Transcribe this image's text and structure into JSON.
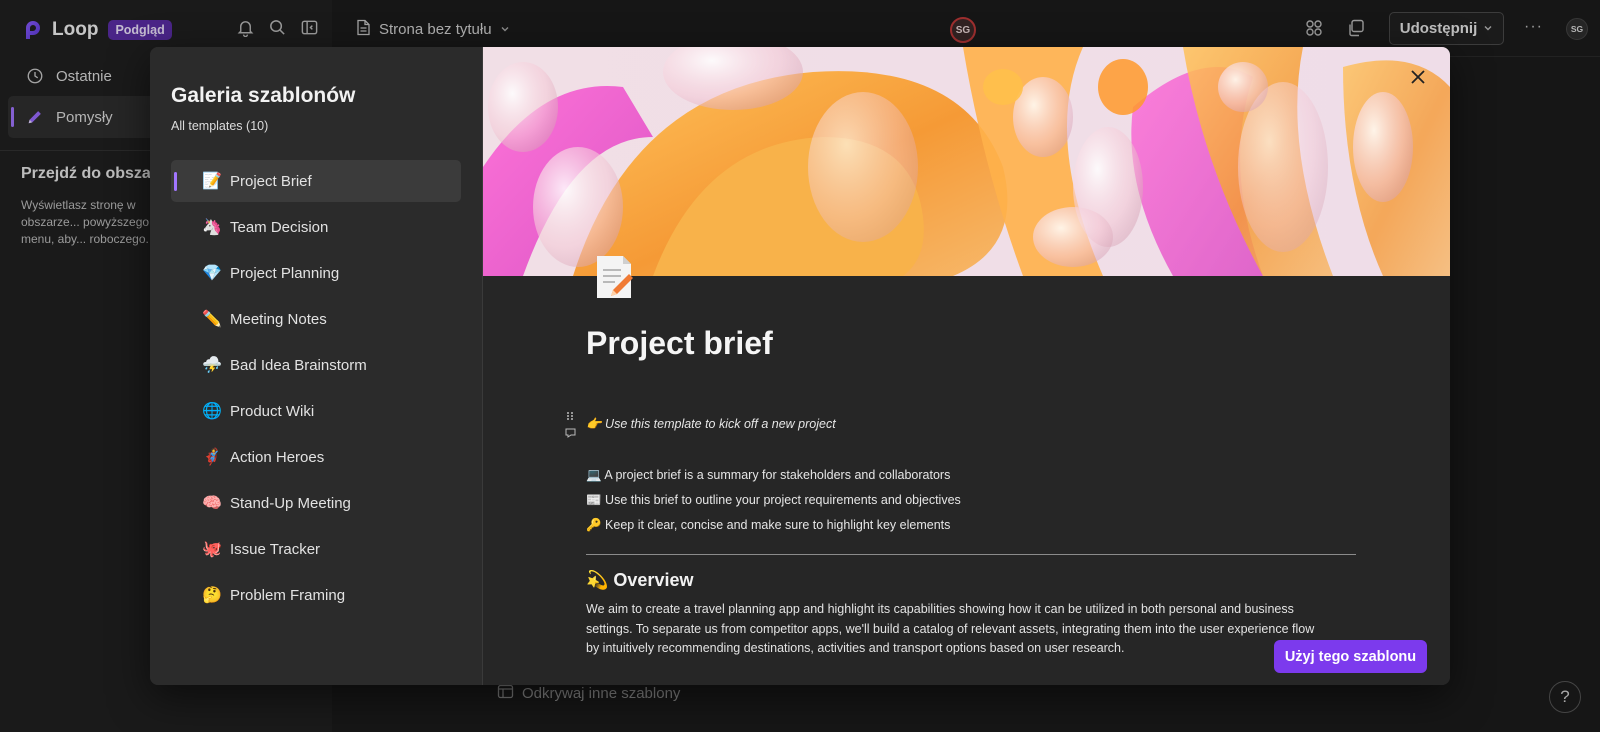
{
  "app": {
    "name": "Loop",
    "badge": "Podgląd"
  },
  "sidebar": {
    "items": [
      {
        "label": "Ostatnie",
        "icon": "clock-icon"
      },
      {
        "label": "Pomysły",
        "icon": "pen-icon"
      }
    ],
    "goto_title": "Przejdź do obszaru roboczego",
    "goto_desc": "Wyświetlasz stronę w obszarze... powyższego menu, aby... roboczego."
  },
  "topbar": {
    "doc_title": "Strona bez tytułu",
    "avatar_initials": "SG",
    "share_label": "Udostępnij",
    "more_label": "···",
    "avatar_right": "SG"
  },
  "footer": {
    "explore_label": "Odkrywaj inne szablony",
    "help_label": "?"
  },
  "gallery": {
    "title": "Galeria szablonów",
    "count_label": "All templates (10)",
    "templates": [
      {
        "emoji": "📝",
        "label": "Project Brief",
        "active": true
      },
      {
        "emoji": "🦄",
        "label": "Team Decision"
      },
      {
        "emoji": "💎",
        "label": "Project Planning"
      },
      {
        "emoji": "✏️",
        "label": "Meeting Notes"
      },
      {
        "emoji": "⛈️",
        "label": "Bad Idea Brainstorm"
      },
      {
        "emoji": "🌐",
        "label": "Product Wiki"
      },
      {
        "emoji": "🦸",
        "label": "Action Heroes"
      },
      {
        "emoji": "🧠",
        "label": "Stand-Up Meeting"
      },
      {
        "emoji": "🐙",
        "label": "Issue Tracker"
      },
      {
        "emoji": "🤔",
        "label": "Problem Framing"
      }
    ]
  },
  "preview": {
    "heading": "Project brief",
    "intro": "👉 Use this template to kick off a new project",
    "bullets": [
      "💻 A project brief is a summary for stakeholders and collaborators",
      "📰 Use this brief to outline your project requirements and objectives",
      "🔑 Keep it clear, concise and make sure to highlight key elements"
    ],
    "overview_title": "💫 Overview",
    "overview_text": "We aim to create a travel planning app and highlight its capabilities showing how it can be utilized in both personal and business settings. To separate us from competitor apps, we'll build a catalog of relevant assets, integrating them into the user experience flow by intuitively recommending destinations, activities and transport options based on user research.",
    "use_button": "Użyj tego szablonu"
  },
  "colors": {
    "accent": "#7c3aed",
    "selection": "#a276ff",
    "hero_orange": "#f6a23c",
    "hero_pink": "#e64fc8"
  }
}
